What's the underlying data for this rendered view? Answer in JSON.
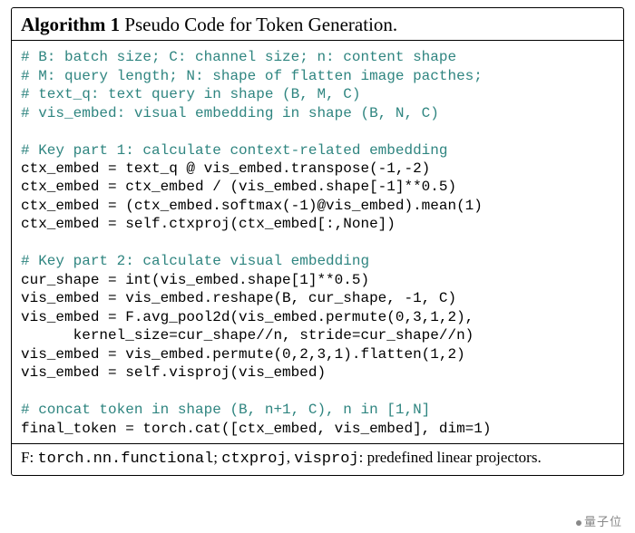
{
  "algorithm": {
    "label": "Algorithm 1",
    "title": "Pseudo Code for Token Generation.",
    "comments_block1": [
      "# B: batch size; C: channel size; n: content shape",
      "# M: query length; N: shape of flatten image pacthes;",
      "# text_q: text query in shape (B, M, C)",
      "# vis_embed: visual embedding in shape (B, N, C)"
    ],
    "comment_key1": "# Key part 1: calculate context-related embedding",
    "code_key1": [
      "ctx_embed = text_q @ vis_embed.transpose(-1,-2)",
      "ctx_embed = ctx_embed / (vis_embed.shape[-1]**0.5)",
      "ctx_embed = (ctx_embed.softmax(-1)@vis_embed).mean(1)",
      "ctx_embed = self.ctxproj(ctx_embed[:,None])"
    ],
    "comment_key2": "# Key part 2: calculate visual embedding",
    "code_key2": [
      "cur_shape = int(vis_embed.shape[1]**0.5)",
      "vis_embed = vis_embed.reshape(B, cur_shape, -1, C)",
      "vis_embed = F.avg_pool2d(vis_embed.permute(0,3,1,2),",
      "      kernel_size=cur_shape//n, stride=cur_shape//n)",
      "vis_embed = vis_embed.permute(0,2,3,1).flatten(1,2)",
      "vis_embed = self.visproj(vis_embed)"
    ],
    "comment_concat": "# concat token in shape (B, n+1, C), n in [1,N]",
    "code_concat": "final_token = torch.cat([ctx_embed, vis_embed], dim=1)",
    "footer": {
      "f_label": "F:",
      "f_val": "torch.nn.functional",
      "sep": "; ",
      "proj1": "ctxproj",
      "comma": ", ",
      "proj2": "visproj",
      "colon": ": ",
      "tail": "predefined linear projectors."
    }
  },
  "watermark": "量子位"
}
